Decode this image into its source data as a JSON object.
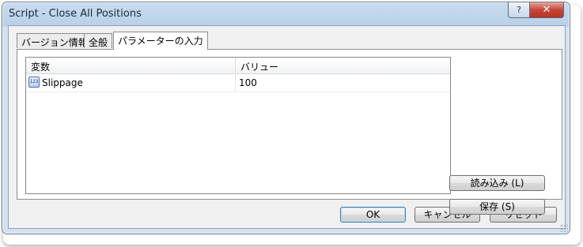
{
  "window": {
    "title": "Script - Close All Positions",
    "help_label": "?",
    "close_label": "✕"
  },
  "tabs": [
    {
      "label": "バージョン情報",
      "active": false
    },
    {
      "label": "全般",
      "active": false
    },
    {
      "label": "パラメーターの入力",
      "active": true
    }
  ],
  "params": {
    "columns": [
      "変数",
      "バリュー"
    ],
    "rows": [
      {
        "type_icon": "123",
        "name": "Slippage",
        "value": "100"
      }
    ]
  },
  "side_buttons": {
    "load_label": "読み込み (L)",
    "save_label": "保存 (S)"
  },
  "dialog_buttons": {
    "ok_label": "OK",
    "cancel_label": "キャンセル",
    "reset_label": "リセット"
  }
}
